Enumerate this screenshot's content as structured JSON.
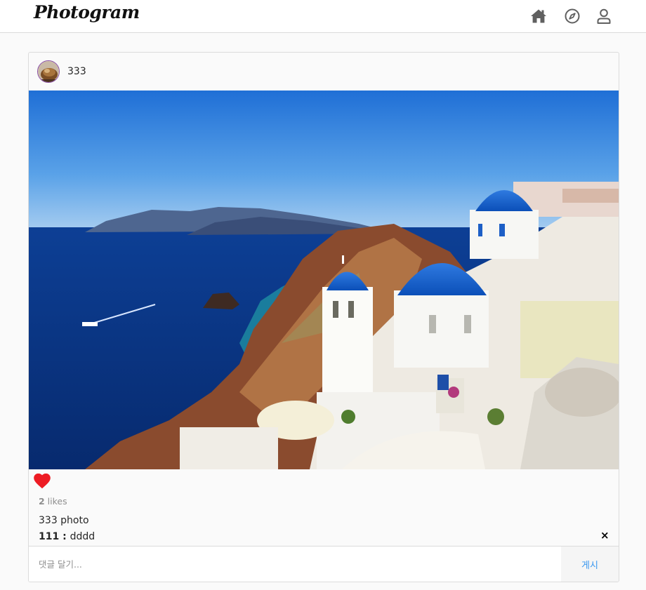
{
  "header": {
    "logo": "Photogram",
    "nav": [
      {
        "icon": "home-icon"
      },
      {
        "icon": "compass-icon"
      },
      {
        "icon": "user-icon"
      }
    ]
  },
  "post": {
    "username": "333",
    "likes_count": "2",
    "likes_suffix": " likes",
    "liked": true,
    "caption": "333 photo",
    "comments": [
      {
        "author": "111",
        "separator": " : ",
        "text": "dddd"
      }
    ],
    "delete_glyph": "×",
    "comment_placeholder": "댓글 달기...",
    "post_label": "게시"
  },
  "colors": {
    "like": "#ed1c24",
    "post_button": "#3897f0",
    "avatar_border": "#8a4ea6"
  }
}
